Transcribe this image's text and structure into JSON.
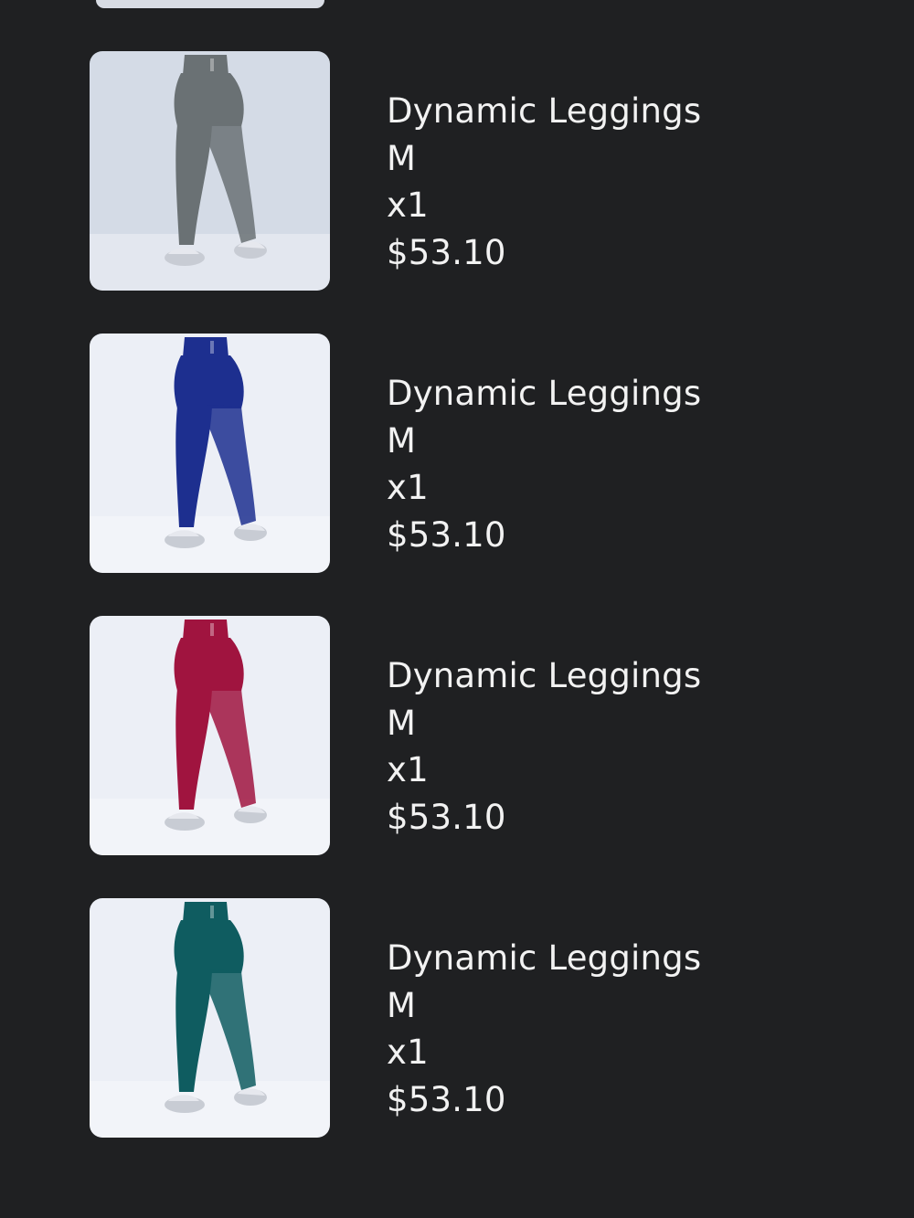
{
  "order": {
    "items": [
      {
        "name": "Dynamic Leggings",
        "size": "M",
        "quantity": "x1",
        "price": "$53.10",
        "image_icon": "grey-leggings-photo",
        "legging_color": "#6a7174",
        "background_color": "#d4dbe6"
      },
      {
        "name": "Dynamic Leggings",
        "size": "M",
        "quantity": "x1",
        "price": "$53.10",
        "image_icon": "navy-leggings-photo",
        "legging_color": "#1d2f8f",
        "background_color": "#eceff6"
      },
      {
        "name": "Dynamic Leggings",
        "size": "M",
        "quantity": "x1",
        "price": "$53.10",
        "image_icon": "berry-leggings-photo",
        "legging_color": "#a0143f",
        "background_color": "#eceff6"
      },
      {
        "name": "Dynamic Leggings",
        "size": "M",
        "quantity": "x1",
        "price": "$53.10",
        "image_icon": "teal-leggings-photo",
        "legging_color": "#0f5c60",
        "background_color": "#eceff6"
      }
    ]
  },
  "colors": {
    "page_background": "#1f2022",
    "text": "#f2f2f2"
  }
}
